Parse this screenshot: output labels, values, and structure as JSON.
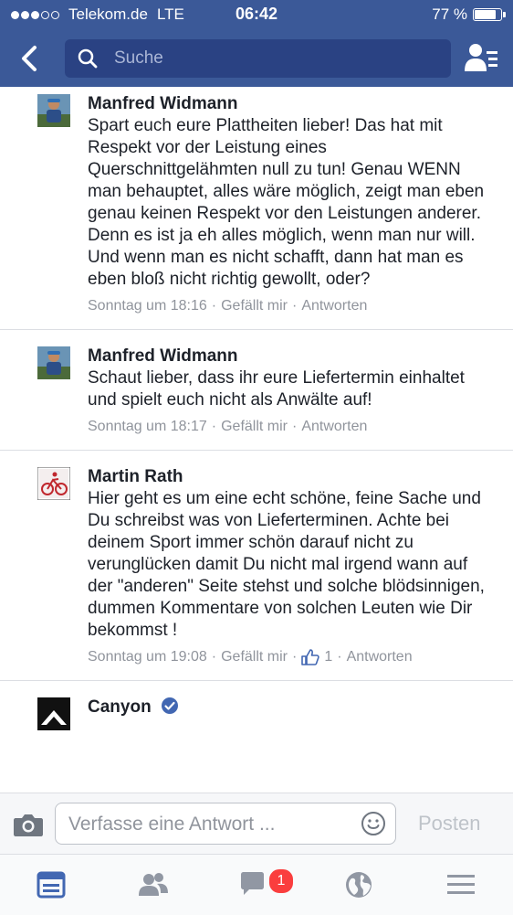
{
  "status_bar": {
    "carrier": "Telekom.de",
    "network": "LTE",
    "time": "06:42",
    "battery": "77 %",
    "battery_level": 0.77,
    "signal_bars": 3
  },
  "nav": {
    "search_placeholder": "Suche"
  },
  "comments": [
    {
      "author": "Manfred Widmann",
      "text": "Spart euch eure Plattheiten lieber! Das hat mit Respekt vor der Leistung eines Querschnittgelähmten null zu tun! Genau WENN man behauptet, alles wäre möglich, zeigt man eben genau keinen Respekt vor den Leistungen anderer. Denn es ist ja eh alles möglich, wenn man nur will. Und wenn man es nicht schafft, dann hat man es eben bloß nicht richtig gewollt, oder?",
      "time": "Sonntag um 18:16",
      "like_label": "Gefällt mir",
      "reply_label": "Antworten"
    },
    {
      "author": "Manfred Widmann",
      "text": "Schaut lieber, dass ihr eure Liefertermin einhaltet und spielt euch nicht als Anwälte auf!",
      "time": "Sonntag um 18:17",
      "like_label": "Gefällt mir",
      "reply_label": "Antworten"
    },
    {
      "author": "Martin Rath",
      "text": "Hier geht es um eine echt schöne, feine Sache und Du schreibst was von Lieferterminen. Achte bei deinem Sport immer schön darauf nicht zu verunglücken damit Du nicht mal irgend wann auf der \"anderen\" Seite stehst und solche blödsinnigen, dummen Kommentare von solchen Leuten wie Dir bekommst !",
      "time": "Sonntag um 19:08",
      "like_label": "Gefällt mir",
      "like_count": "1",
      "reply_label": "Antworten"
    },
    {
      "author": "Canyon",
      "verified": true
    }
  ],
  "composer": {
    "placeholder": "Verfasse eine Antwort ...",
    "post_label": "Posten"
  },
  "tabbar": {
    "messages_badge": "1"
  },
  "colors": {
    "brand": "#3b5998",
    "search_bg": "#2a4283",
    "meta_text": "#90949c",
    "badge": "#fa3e3e",
    "verified": "#4267b2"
  },
  "icons": [
    "back-arrow-icon",
    "search-icon",
    "friend-requests-icon",
    "camera-icon",
    "smiley-icon",
    "news-feed-icon",
    "friends-icon",
    "messages-icon",
    "notifications-globe-icon",
    "menu-icon",
    "like-thumb-icon",
    "verified-badge-icon"
  ]
}
